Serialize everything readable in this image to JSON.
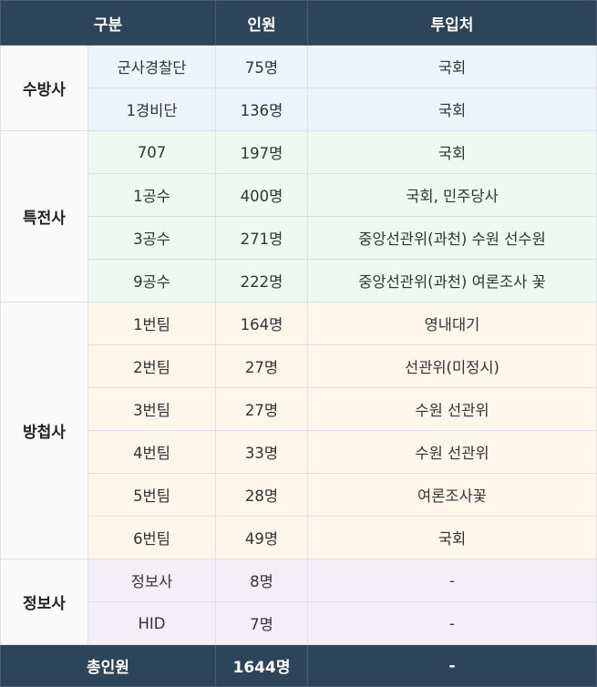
{
  "header": {
    "col1": "구분",
    "col2": "인원",
    "col3": "투입처"
  },
  "groups": [
    {
      "name": "수방사",
      "rows": [
        {
          "unit": "군사경찰단",
          "count": "75명",
          "target": "국회"
        },
        {
          "unit": "1경비단",
          "count": "136명",
          "target": "국회"
        }
      ]
    },
    {
      "name": "특전사",
      "rows": [
        {
          "unit": "707",
          "count": "197명",
          "target": "국회"
        },
        {
          "unit": "1공수",
          "count": "400명",
          "target": "국회, 민주당사"
        },
        {
          "unit": "3공수",
          "count": "271명",
          "target": "중앙선관위(과천) 수원 선수원"
        },
        {
          "unit": "9공수",
          "count": "222명",
          "target": "중앙선관위(과천) 여론조사 꽃"
        }
      ]
    },
    {
      "name": "방첩사",
      "rows": [
        {
          "unit": "1번팀",
          "count": "164명",
          "target": "영내대기"
        },
        {
          "unit": "2번팀",
          "count": "27명",
          "target": "선관위(미정시)"
        },
        {
          "unit": "3번팀",
          "count": "27명",
          "target": "수원 선관위"
        },
        {
          "unit": "4번팀",
          "count": "33명",
          "target": "수원 선관위"
        },
        {
          "unit": "5번팀",
          "count": "28명",
          "target": "여론조사꽃"
        },
        {
          "unit": "6번팀",
          "count": "49명",
          "target": "국회"
        }
      ]
    },
    {
      "name": "정보사",
      "rows": [
        {
          "unit": "정보사",
          "count": "8명",
          "target": "-"
        },
        {
          "unit": "HID",
          "count": "7명",
          "target": "-"
        }
      ]
    }
  ],
  "footer": {
    "label": "총인원",
    "total": "1644명",
    "target": "-"
  }
}
